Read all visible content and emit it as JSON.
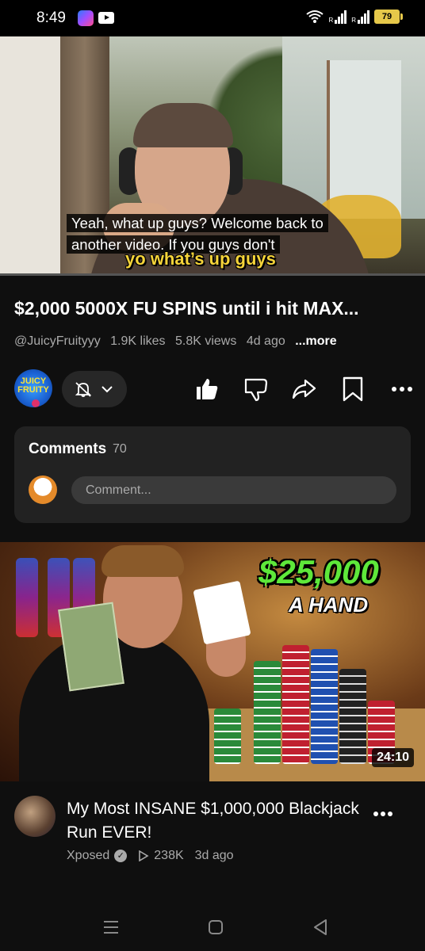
{
  "status_bar": {
    "time": "8:49",
    "battery": "79",
    "signal1": "R",
    "signal2": "R"
  },
  "player": {
    "caption_line1": "Yeah, what up guys? Welcome back to",
    "caption_line2": "another video. If you guys don't",
    "burned_text": "yo what’s up guys",
    "progress": 0.0
  },
  "video": {
    "title": "$2,000 5000X FU SPINS until i hit MAX...",
    "channel": "@JuicyFruityyy",
    "likes": "1.9K likes",
    "views": "5.8K views",
    "age": "4d ago",
    "more": "...more",
    "channel_logo_text": "JUICY FRUITY"
  },
  "comments": {
    "label": "Comments",
    "count": "70",
    "placeholder": "Comment..."
  },
  "recommendation": {
    "thumb_price": "$25,000",
    "thumb_sub": "A HAND",
    "duration": "24:10",
    "title": "My Most INSANE $1,000,000 Blackjack Run EVER!",
    "channel": "Xposed",
    "views": "238K",
    "age": "3d ago"
  },
  "colors": {
    "background": "#0f0f0f",
    "surface": "#222222",
    "accent_red": "#ff0000",
    "price_green": "#5ee83a"
  }
}
